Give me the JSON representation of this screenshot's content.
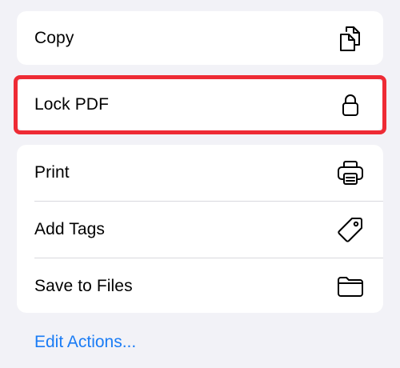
{
  "menu": {
    "copy": {
      "label": "Copy",
      "icon": "copy-icon"
    },
    "lock_pdf": {
      "label": "Lock PDF",
      "icon": "lock-icon"
    },
    "print": {
      "label": "Print",
      "icon": "printer-icon"
    },
    "add_tags": {
      "label": "Add Tags",
      "icon": "tag-icon"
    },
    "save_to_files": {
      "label": "Save to Files",
      "icon": "folder-icon"
    }
  },
  "edit_actions_label": "Edit Actions...",
  "colors": {
    "highlight": "#ee2b35",
    "link": "#1a7cf5",
    "background": "#f2f2f7"
  }
}
